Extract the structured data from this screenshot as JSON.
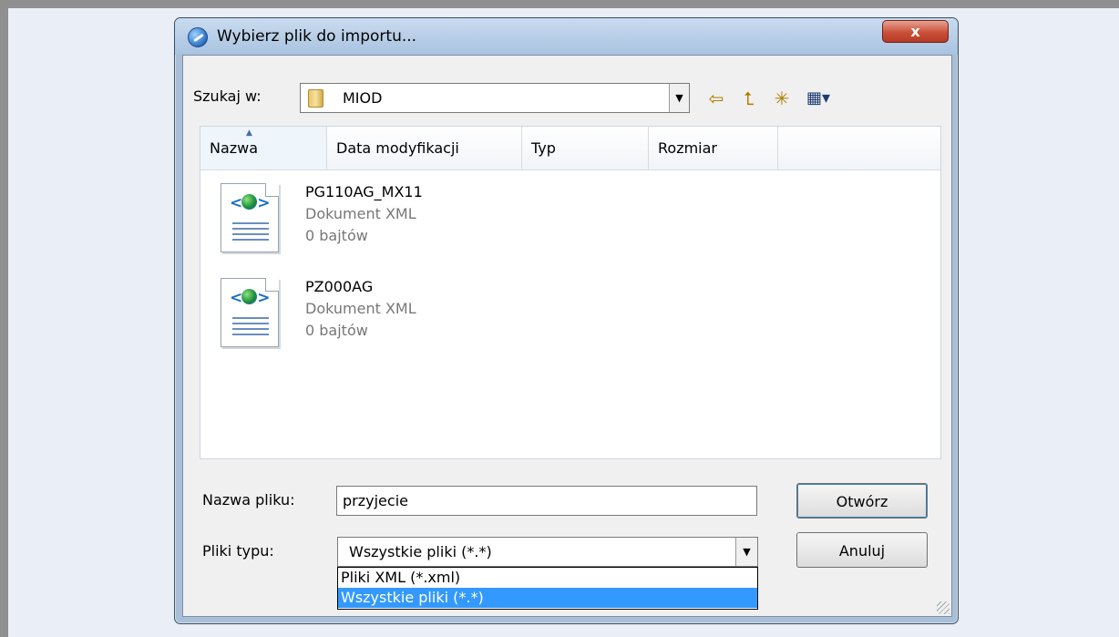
{
  "dialog": {
    "title": "Wybierz plik do importu...",
    "close_label": "x"
  },
  "lookin": {
    "label": "Szukaj w:",
    "value": "MIOD"
  },
  "toolbar": {
    "back_icon": "arrow-left-icon",
    "up_icon": "folder-up-icon",
    "new_folder_icon": "new-folder-icon",
    "view_menu_icon": "view-menu-icon"
  },
  "list": {
    "columns": [
      "Nazwa",
      "Data modyfikacji",
      "Typ",
      "Rozmiar"
    ],
    "files": [
      {
        "name": "PG110AG_MX11",
        "type": "Dokument XML",
        "size": "0 bajtów"
      },
      {
        "name": "PZ000AG",
        "type": "Dokument XML",
        "size": "0 bajtów"
      }
    ]
  },
  "filename": {
    "label": "Nazwa pliku:",
    "value": "przyjecie"
  },
  "filetype": {
    "label": "Pliki typu:",
    "value": "Wszystkie pliki (*.*)",
    "options": [
      "Pliki XML (*.xml)",
      "Wszystkie pliki (*.*)"
    ]
  },
  "buttons": {
    "open": "Otwórz",
    "cancel": "Anuluj"
  },
  "colors": {
    "selection": "#3399ff",
    "close_button": "#c9503a"
  }
}
